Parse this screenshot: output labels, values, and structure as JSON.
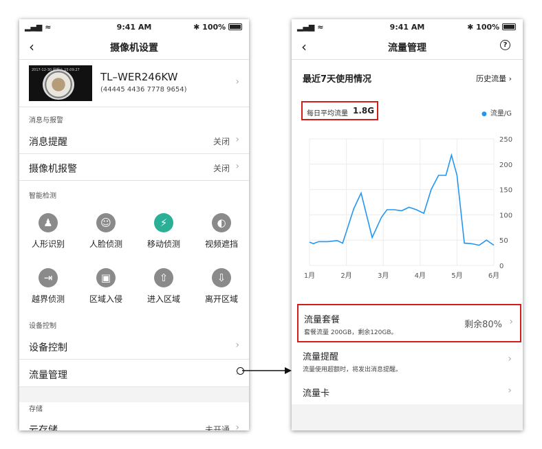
{
  "status": {
    "time": "9:41 AM",
    "battery": "100%"
  },
  "left": {
    "title": "摄像机设置",
    "device": {
      "name": "TL–WER246KW",
      "id": "(44445 4436 7778 9654)",
      "thumb_timestamp": "2017-12-30 星期六 15:09:27"
    },
    "sections": {
      "alerts": "消息与报警",
      "smart": "智能检测",
      "device_ctrl": "设备控制",
      "storage": "存储"
    },
    "rows": {
      "msg_remind": {
        "label": "消息提醒",
        "value": "关闭"
      },
      "cam_alarm": {
        "label": "摄像机报警",
        "value": "关闭"
      },
      "device_control": {
        "label": "设备控制"
      },
      "traffic_mgmt": {
        "label": "流量管理"
      },
      "cloud_storage": {
        "label": "云存储",
        "value": "未开通"
      }
    },
    "features": [
      {
        "label": "人形识别",
        "icon": "person-icon",
        "glyph": "♟",
        "active": false
      },
      {
        "label": "人脸侦测",
        "icon": "face-icon",
        "glyph": "☺",
        "active": false
      },
      {
        "label": "移动侦测",
        "icon": "running-icon",
        "glyph": "⚡",
        "active": true
      },
      {
        "label": "视频遮挡",
        "icon": "occlusion-icon",
        "glyph": "◐",
        "active": false
      },
      {
        "label": "越界侦测",
        "icon": "cross-line-icon",
        "glyph": "⇥",
        "active": false
      },
      {
        "label": "区域入侵",
        "icon": "region-icon",
        "glyph": "▣",
        "active": false
      },
      {
        "label": "进入区域",
        "icon": "enter-area-icon",
        "glyph": "⇧",
        "active": false
      },
      {
        "label": "离开区域",
        "icon": "leave-area-icon",
        "glyph": "⇩",
        "active": false
      }
    ]
  },
  "right": {
    "title": "流量管理",
    "usage_title": "最近7天使用情况",
    "history_link": "历史流量",
    "avg_label": "每日平均流量",
    "avg_value": "1.8G",
    "legend": "流量/G",
    "plan": {
      "title": "流量套餐",
      "sub": "套餐流量 200GB，剩余120GB。",
      "remain": "剩余80%"
    },
    "reminder": {
      "title": "流量提醒",
      "sub": "流量使用超额时，将发出消息提醒。"
    },
    "sim": {
      "title": "流量卡"
    }
  },
  "colors": {
    "accent": "#2ab097",
    "line": "#2196f3",
    "highlight": "#d21b1b"
  },
  "chart_data": {
    "type": "line",
    "x": [
      1.0,
      1.1,
      1.25,
      1.5,
      1.75,
      1.9,
      2.2,
      2.4,
      2.7,
      2.95,
      3.1,
      3.3,
      3.5,
      3.7,
      3.9,
      4.1,
      4.3,
      4.5,
      4.7,
      4.85,
      5.0,
      5.2,
      5.4,
      5.6,
      5.8,
      6.0
    ],
    "values": [
      46,
      43,
      47,
      47,
      49,
      44,
      112,
      143,
      55,
      95,
      110,
      110,
      108,
      115,
      110,
      103,
      150,
      178,
      178,
      218,
      178,
      44,
      43,
      40,
      50,
      40
    ],
    "xlabels": [
      "1月",
      "2月",
      "3月",
      "4月",
      "5月",
      "6月"
    ],
    "ytick_values": [
      0,
      50,
      100,
      150,
      200,
      250
    ],
    "ylim": [
      0,
      250
    ],
    "xlim": [
      1,
      6
    ],
    "grid": true
  }
}
